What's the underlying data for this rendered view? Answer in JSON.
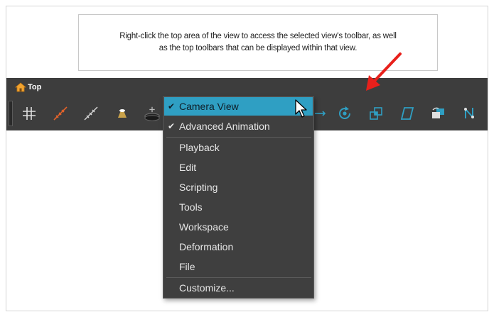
{
  "callout": {
    "line1": "Right-click the top area of the view to access the selected view's toolbar, as well",
    "line2": "as the top toolbars that can be displayed within that view."
  },
  "view": {
    "tab_label": "Top"
  },
  "context_menu": {
    "items": [
      {
        "label": "Camera View",
        "checked": true,
        "highlighted": true
      },
      {
        "label": "Advanced Animation",
        "checked": true,
        "highlighted": false
      },
      {
        "label": "Playback",
        "checked": false
      },
      {
        "label": "Edit",
        "checked": false
      },
      {
        "label": "Scripting",
        "checked": false
      },
      {
        "label": "Tools",
        "checked": false
      },
      {
        "label": "Workspace",
        "checked": false
      },
      {
        "label": "Deformation",
        "checked": false
      },
      {
        "label": "File",
        "checked": false
      },
      {
        "label": "Customize...",
        "checked": false
      }
    ],
    "check_glyph": "✔"
  },
  "toolbar": {
    "icons": [
      "grid-icon",
      "onion-skin-icon",
      "light-table-icon",
      "turn-off-image-icon",
      "add-layer-icon",
      "translate-icon",
      "rotate-icon",
      "scale-icon",
      "skew-icon",
      "hierarchy-icon",
      "transform-icon"
    ]
  },
  "colors": {
    "toolbar_bg": "#3d3d3d",
    "menu_bg": "#3f3f3f",
    "menu_highlight": "#2f9fc3",
    "accent_orange": "#e2622a",
    "accent_blue": "#2f9fc3",
    "annotation_red": "#e8201b"
  }
}
